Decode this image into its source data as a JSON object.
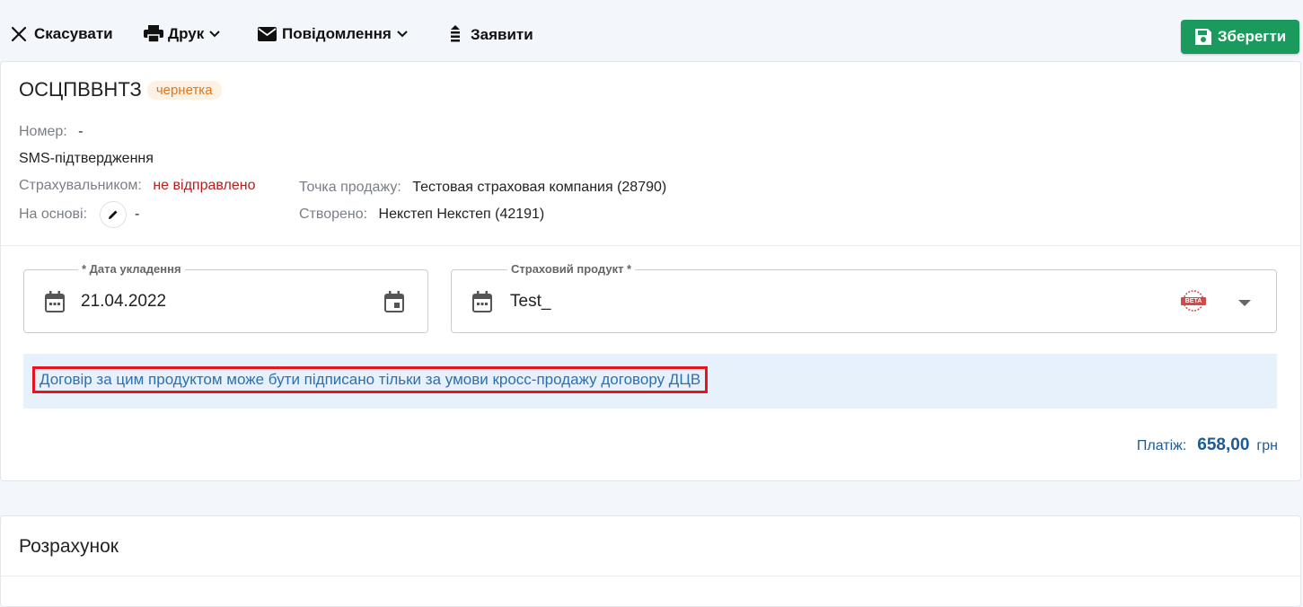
{
  "toolbar": {
    "cancel_label": "Скасувати",
    "print_label": "Друк",
    "notifications_label": "Повідомлення",
    "declare_label": "Заявити",
    "save_label": "Зберегти"
  },
  "document": {
    "title": "ОСЦПВВНТЗ",
    "status": "чернетка",
    "number_label": "Номер:",
    "number_value": "-",
    "sms_label": "SMS-підтвердження",
    "insurer_label": "Страхувальником:",
    "insurer_value": "не відправлено",
    "based_on_label": "На основі:",
    "based_on_value": "-",
    "sale_point_label": "Точка продажу:",
    "sale_point_value": "Тестовая страховая компания (28790)",
    "created_label": "Створено:",
    "created_value": "Некстеп Некстеп (42191)"
  },
  "form": {
    "date_label": "* Дата укладення",
    "date_value": "21.04.2022",
    "product_label": "Страховий продукт *",
    "product_value": "Test_",
    "beta_badge": "BETA"
  },
  "notice": {
    "text": "Договір за цим продуктом може бути підписано тільки за умови кросс-продажу договору ДЦВ"
  },
  "payment": {
    "label": "Платіж:",
    "value": "658,00",
    "currency": "грн"
  },
  "calculation": {
    "title": "Розрахунок"
  },
  "colors": {
    "save_button": "#1a9a5c",
    "status_draft": "#d9771e",
    "link_blue": "#2f6fb0",
    "highlight_red": "#e8141b"
  }
}
